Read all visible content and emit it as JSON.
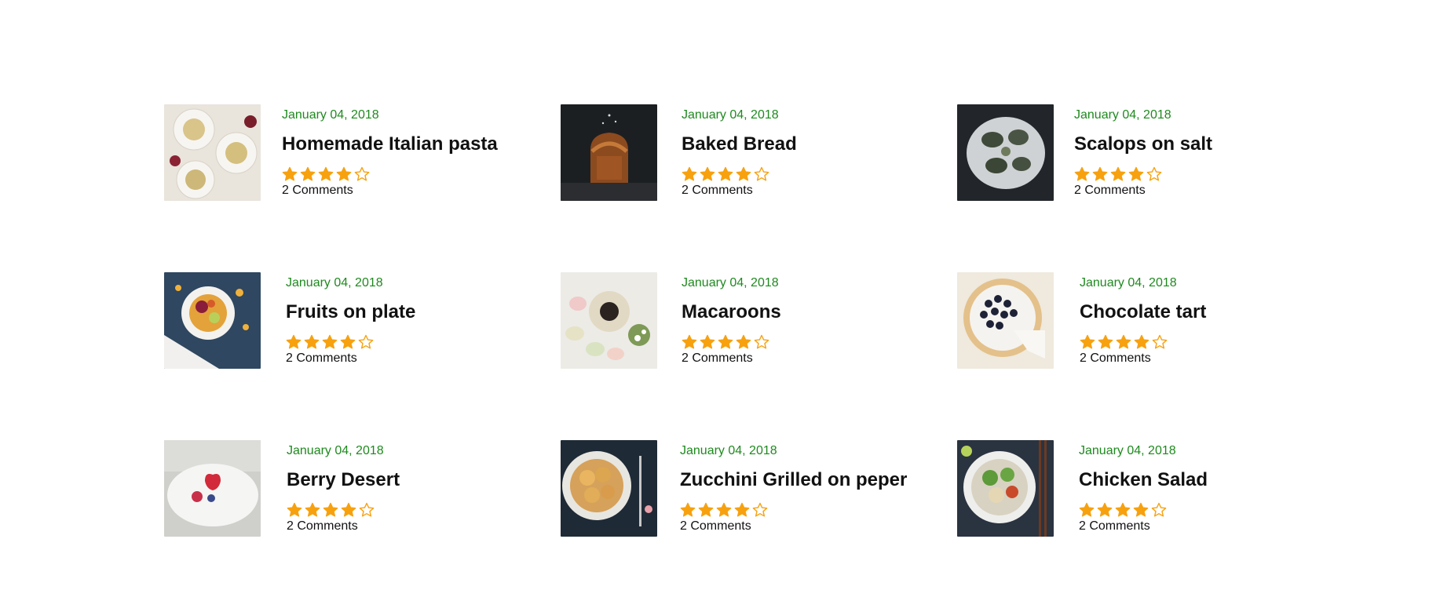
{
  "colors": {
    "date": "#1e8a1e",
    "star": "#f7a10f",
    "text": "#111111"
  },
  "rating_max": 5,
  "posts": [
    {
      "date": "January 04, 2018",
      "title": "Homemade Italian pasta",
      "rating": 4,
      "comments": "2 Comments",
      "image_icon": "pasta-image"
    },
    {
      "date": "January 04, 2018",
      "title": "Baked Bread",
      "rating": 4,
      "comments": "2 Comments",
      "image_icon": "bread-image"
    },
    {
      "date": "January 04, 2018",
      "title": "Scalops on salt",
      "rating": 4,
      "comments": "2 Comments",
      "image_icon": "scallops-image"
    },
    {
      "date": "January 04, 2018",
      "title": "Fruits on plate",
      "rating": 4,
      "comments": "2 Comments",
      "image_icon": "fruits-image"
    },
    {
      "date": "January 04, 2018",
      "title": "Macaroons",
      "rating": 4,
      "comments": "2 Comments",
      "image_icon": "macaroons-image"
    },
    {
      "date": "January 04, 2018",
      "title": "Chocolate tart",
      "rating": 4,
      "comments": "2 Comments",
      "image_icon": "tart-image"
    },
    {
      "date": "January 04, 2018",
      "title": "Berry Desert",
      "rating": 4,
      "comments": "2 Comments",
      "image_icon": "berry-image"
    },
    {
      "date": "January 04, 2018",
      "title": "Zucchini Grilled on peper",
      "rating": 4,
      "comments": "2 Comments",
      "image_icon": "zucchini-image"
    },
    {
      "date": "January 04, 2018",
      "title": "Chicken Salad",
      "rating": 4,
      "comments": "2 Comments",
      "image_icon": "salad-image"
    }
  ]
}
